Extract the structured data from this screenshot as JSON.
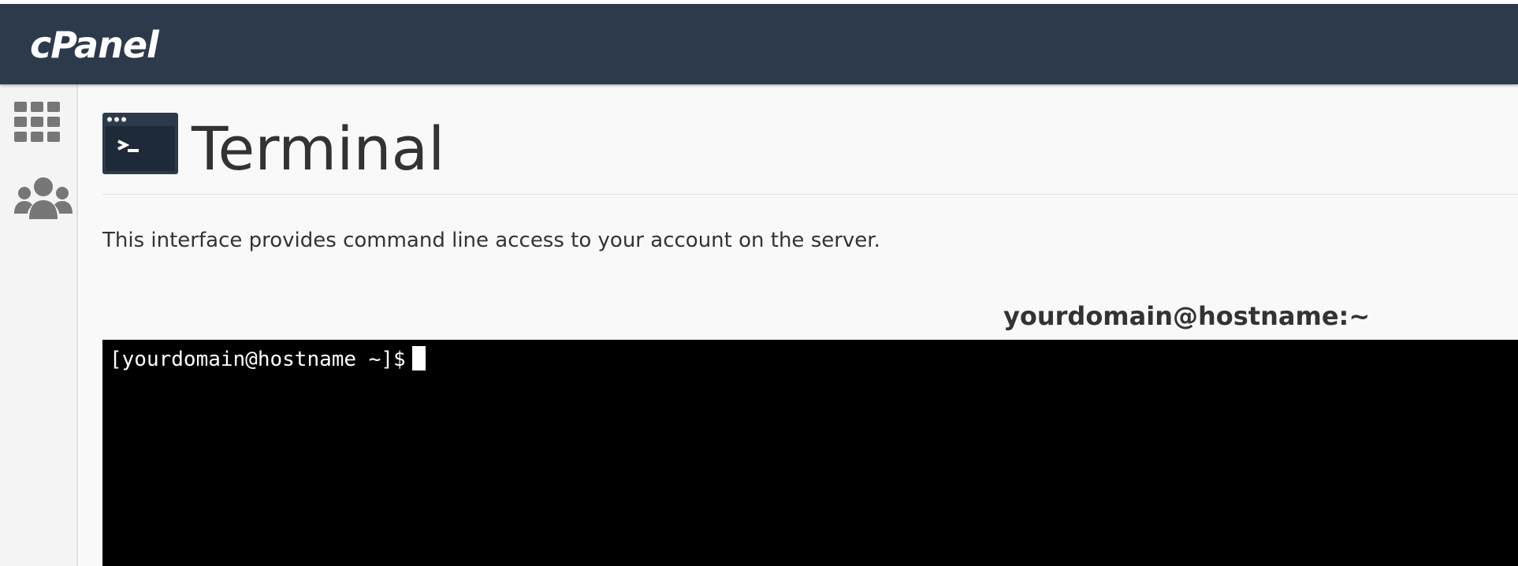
{
  "header": {
    "logo_text": "cPanel",
    "background_color": "#2d3a4b"
  },
  "sidebar": {
    "items": [
      {
        "icon": "grid-icon"
      },
      {
        "icon": "users-icon"
      }
    ]
  },
  "page": {
    "icon": "terminal-icon",
    "title": "Terminal",
    "description": "This interface provides command line access to your account on the server."
  },
  "terminal": {
    "title": "yourdomain@hostname:~",
    "prompt": "[yourdomain@hostname ~]$",
    "background_color": "#000000",
    "text_color": "#ffffff"
  }
}
